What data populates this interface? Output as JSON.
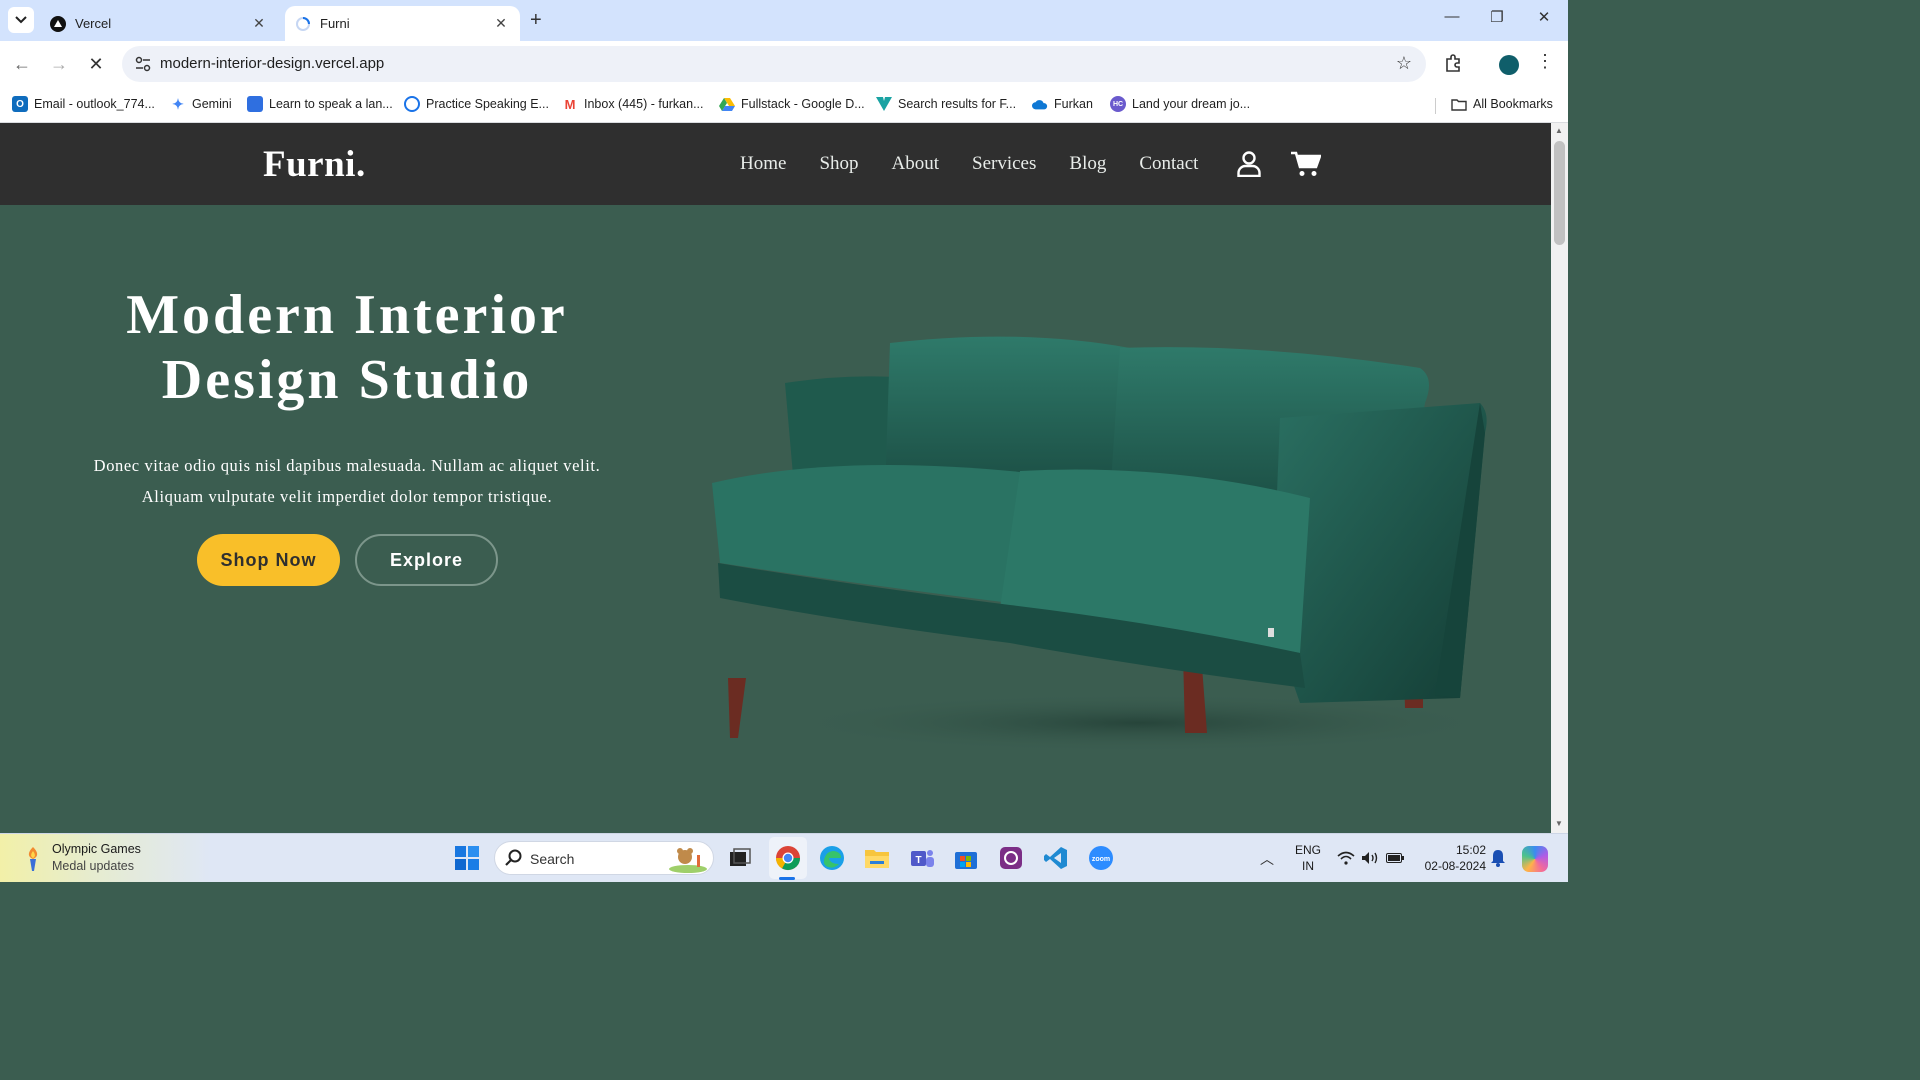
{
  "browser": {
    "tabs": [
      {
        "title": "Vercel",
        "active": false
      },
      {
        "title": "Furni",
        "active": true
      }
    ],
    "url": "modern-interior-design.vercel.app",
    "bookmarks": [
      {
        "label": "Email - outlook_774...",
        "icon": "outlook-icon",
        "color": "#0f6cbd"
      },
      {
        "label": "Gemini",
        "icon": "gemini-icon",
        "color": "#4285f4"
      },
      {
        "label": "Learn to speak a lan...",
        "icon": "language-app-icon",
        "color": "#2f6fe0"
      },
      {
        "label": "Practice Speaking E...",
        "icon": "practice-icon",
        "color": "#1a73e8"
      },
      {
        "label": "Inbox (445) - furkan...",
        "icon": "gmail-icon",
        "color": "#ea4335"
      },
      {
        "label": "Fullstack - Google D...",
        "icon": "google-drive-icon",
        "color": "#34a853"
      },
      {
        "label": "Search results for F...",
        "icon": "vuetify-icon",
        "color": "#1aa3a3"
      },
      {
        "label": "Furkan",
        "icon": "onedrive-icon",
        "color": "#0f78d4"
      },
      {
        "label": "Land your dream jo...",
        "icon": "job-site-icon",
        "color": "#6a5acd"
      }
    ],
    "all_bookmarks": "All Bookmarks"
  },
  "site": {
    "logo": "Furni.",
    "menu": [
      "Home",
      "Shop",
      "About",
      "Services",
      "Blog",
      "Contact"
    ],
    "hero": {
      "title_line1": "Modern Interior",
      "title_line2": "Design Studio",
      "text_line1": "Donec vitae odio quis nisl dapibus malesuada. Nullam ac aliquet velit.",
      "text_line2": "Aliquam vulputate velit imperdiet dolor tempor tristique.",
      "primary_button": "Shop Now",
      "secondary_button": "Explore"
    },
    "colors": {
      "hero_bg": "#3b5d50",
      "nav_bg": "#2f2f2f",
      "accent": "#f9bf29"
    }
  },
  "taskbar": {
    "weather_title": "Olympic Games",
    "weather_subtitle": "Medal updates",
    "search_label": "Search",
    "lang_line1": "ENG",
    "lang_line2": "IN",
    "time": "15:02",
    "date": "02-08-2024"
  }
}
